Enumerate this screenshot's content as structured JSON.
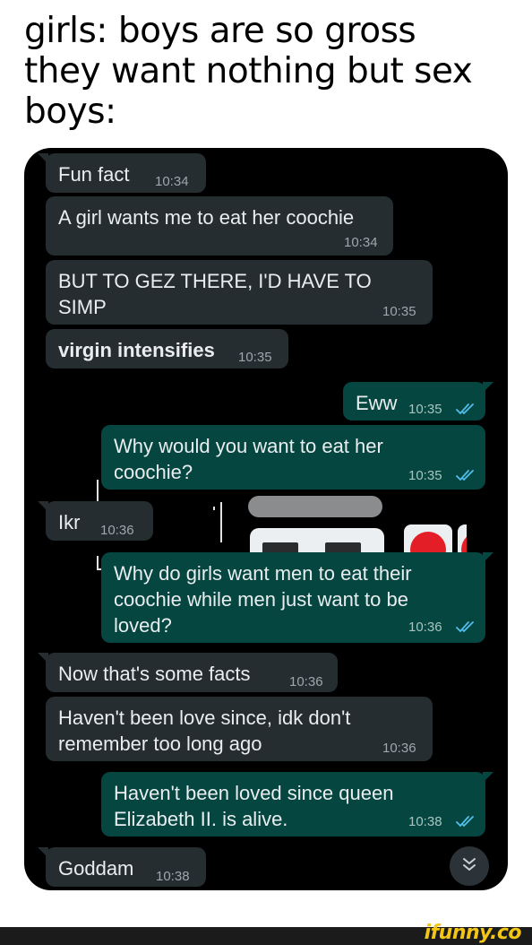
{
  "caption": {
    "line1": "girls: boys are so gross",
    "line2": "they want nothing but sex",
    "line3": "boys:"
  },
  "messages": [
    {
      "text": "Fun fact",
      "time": "10:34"
    },
    {
      "text": "A girl wants me to eat her coochie",
      "time": "10:34"
    },
    {
      "text": "BUT TO GEZ THERE, I'D HAVE TO\nSIMP",
      "time": "10:35"
    },
    {
      "text": "virgin intensifies",
      "time": "10:35"
    },
    {
      "text": "Eww",
      "time": "10:35"
    },
    {
      "text": "Why would you want to eat her\ncoochie?",
      "time": "10:35"
    },
    {
      "text": "Ikr",
      "time": "10:36"
    },
    {
      "text": "Why do girls want men to eat their\ncoochie while men just want to be\nloved?",
      "time": "10:36"
    },
    {
      "text": "Now that's some facts",
      "time": "10:36"
    },
    {
      "text": "Haven't been love since, idk don't\nremember too long ago",
      "time": "10:36"
    },
    {
      "text": "Haven't been loved since queen\nElizabeth II. is alive.",
      "time": "10:38"
    },
    {
      "text": "Goddam",
      "time": "10:38"
    }
  ],
  "icons": {
    "read_ticks": "double-check-icon",
    "scroll_down": "chevrons-down-icon"
  },
  "colors": {
    "incoming_bubble": "#262d31",
    "outgoing_bubble": "#054740",
    "read_tick": "#53bdeb",
    "chat_background": "#000000"
  },
  "footer": {
    "logo": "ifunny.co"
  }
}
